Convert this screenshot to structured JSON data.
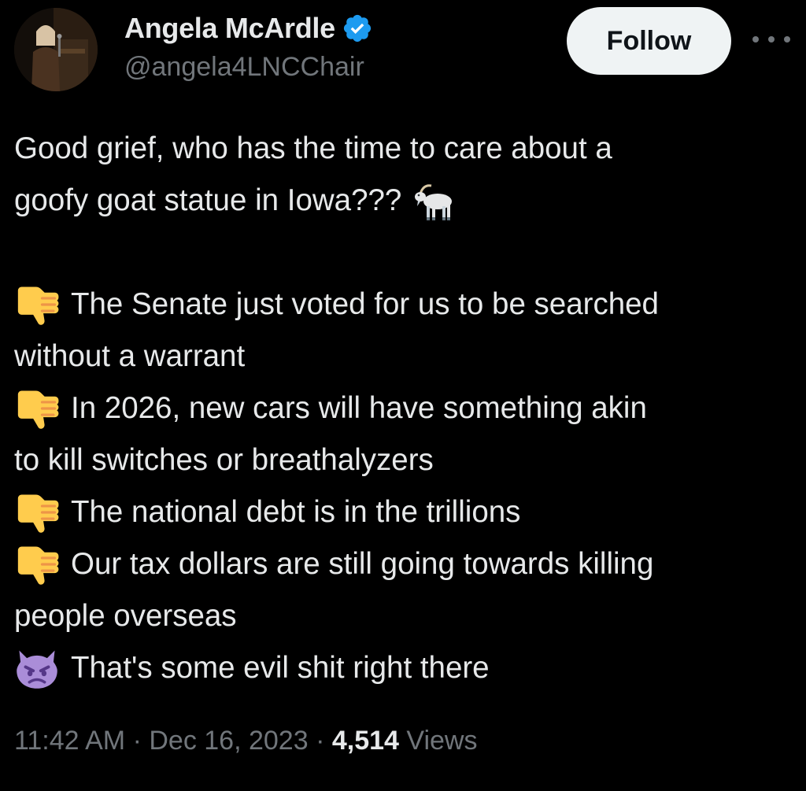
{
  "author": {
    "display_name": "Angela McArdle",
    "handle": "@angela4LNCChair",
    "verified": true
  },
  "actions": {
    "follow_label": "Follow",
    "more_icon": "more-horizontal-icon"
  },
  "tweet": {
    "line1": "Good grief, who has the time to care about a",
    "line2": "goofy goat statue in Iowa???",
    "goat_emoji": "goat-icon",
    "item1_a": "The Senate just voted for us to be searched",
    "item1_b": "without a warrant",
    "item2_a": "In 2026, new cars will have something akin",
    "item2_b": "to kill switches or breathalyzers",
    "item3": "The national debt is in the trillions",
    "item4_a": "Our tax dollars are still going towards killing",
    "item4_b": "people overseas",
    "item5": "That's some evil shit right there",
    "bullet_icon": "thumbs-down-icon",
    "final_icon": "angry-devil-icon"
  },
  "meta": {
    "time": "11:42 AM",
    "sep1": " · ",
    "date": "Dec 16, 2023",
    "sep2": " · ",
    "views_count": "4,514",
    "views_label": "Views"
  },
  "colors": {
    "background": "#000000",
    "text": "#e7e9ea",
    "secondary": "#71767b",
    "verified": "#1d9bf0",
    "follow_bg": "#eff3f4"
  }
}
